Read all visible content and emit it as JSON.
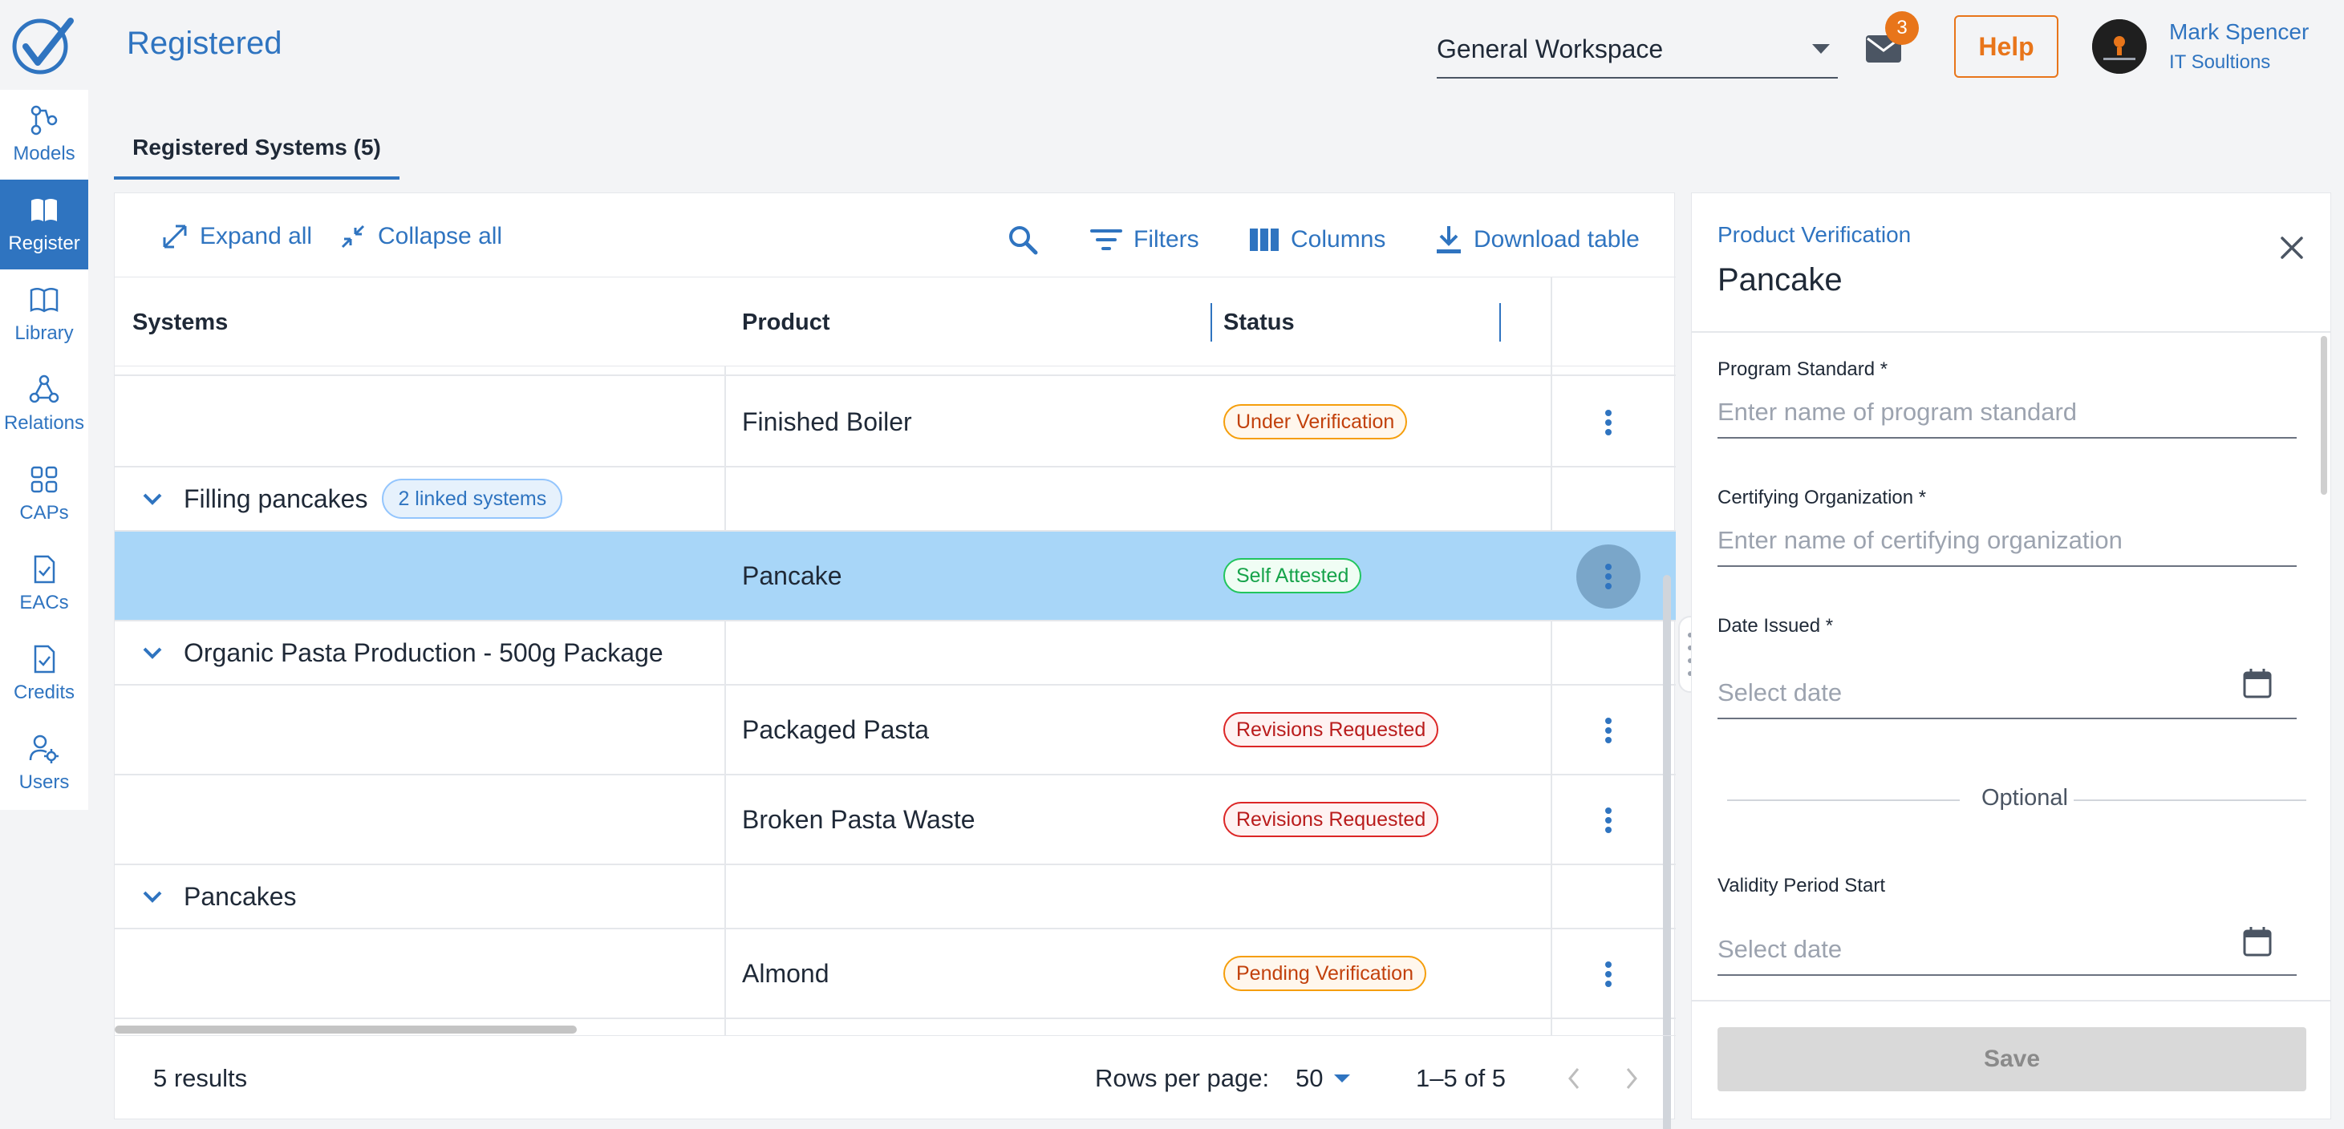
{
  "app": {
    "page_title": "Registered"
  },
  "colors": {
    "accent": "#2f74c0",
    "orange": "#e8751a",
    "selected_row": "#a8d6f8"
  },
  "sidebar": {
    "items": [
      {
        "label": "Models",
        "icon": "models-icon"
      },
      {
        "label": "Register",
        "icon": "book-icon",
        "active": true
      },
      {
        "label": "Library",
        "icon": "open-book-icon"
      },
      {
        "label": "Relations",
        "icon": "relations-icon"
      },
      {
        "label": "CAPs",
        "icon": "grid-icon"
      },
      {
        "label": "EACs",
        "icon": "document-check-icon"
      },
      {
        "label": "Credits",
        "icon": "document-check-icon"
      },
      {
        "label": "Users",
        "icon": "user-gear-icon"
      }
    ]
  },
  "header": {
    "workspace": "General Workspace",
    "mail_count": "3",
    "help_label": "Help",
    "user_name": "Mark Spencer",
    "user_org": "IT Soultions"
  },
  "tabs": [
    {
      "label": "Registered Systems (5)"
    }
  ],
  "toolbar": {
    "expand_all": "Expand all",
    "collapse_all": "Collapse all",
    "filters": "Filters",
    "columns": "Columns",
    "download": "Download table"
  },
  "table": {
    "columns": [
      "Systems",
      "Product",
      "Status"
    ],
    "rows": [
      {
        "type": "product",
        "product": "Finished Boiler",
        "status": "Under Verification",
        "status_tone": "orange"
      },
      {
        "type": "group",
        "system": "Filling pancakes",
        "linked": "2 linked systems"
      },
      {
        "type": "product",
        "product": "Pancake",
        "status": "Self Attested",
        "status_tone": "green",
        "selected": true
      },
      {
        "type": "group",
        "system": "Organic Pasta Production - 500g Package"
      },
      {
        "type": "product",
        "product": "Packaged Pasta",
        "status": "Revisions Requested",
        "status_tone": "red"
      },
      {
        "type": "product",
        "product": "Broken Pasta Waste",
        "status": "Revisions Requested",
        "status_tone": "red"
      },
      {
        "type": "group",
        "system": "Pancakes"
      },
      {
        "type": "product",
        "product": "Almond",
        "status": "Pending Verification",
        "status_tone": "orange"
      }
    ]
  },
  "footer": {
    "results": "5 results",
    "rows_per_page_label": "Rows per page:",
    "rows_per_page": "50",
    "range": "1–5 of 5"
  },
  "panel": {
    "subtitle": "Product Verification",
    "title": "Pancake",
    "program_standard_label": "Program Standard",
    "program_standard_placeholder": "Enter name of program standard",
    "certifying_org_label": "Certifying Organization",
    "certifying_org_placeholder": "Enter name of certifying organization",
    "date_issued_label": "Date Issued",
    "date_issued_placeholder": "Select date",
    "optional_label": "Optional",
    "validity_start_label": "Validity Period Start",
    "validity_start_placeholder": "Select date",
    "required_mark": "*",
    "save_label": "Save"
  }
}
